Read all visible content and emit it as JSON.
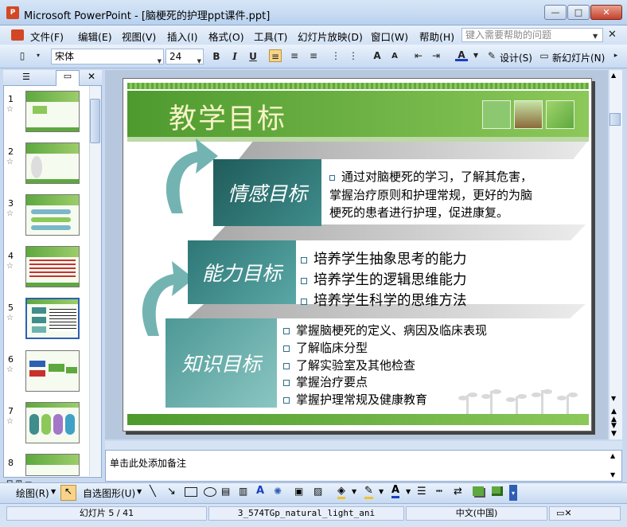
{
  "window": {
    "title": "Microsoft PowerPoint - [脑梗死的护理ppt课件.ppt]",
    "min": "—",
    "max": "□",
    "close": "✕"
  },
  "menu": {
    "items": [
      "文件(F)",
      "编辑(E)",
      "视图(V)",
      "插入(I)",
      "格式(O)",
      "工具(T)",
      "幻灯片放映(D)",
      "窗口(W)",
      "帮助(H)"
    ],
    "help_placeholder": "键入需要帮助的问题"
  },
  "toolbar": {
    "font": "宋体",
    "size": "24",
    "bold": "B",
    "italic": "I",
    "underline": "U",
    "design": "设计(S)",
    "new_slide": "新幻灯片(N)"
  },
  "thumbnails": {
    "numbers": [
      "1",
      "2",
      "3",
      "4",
      "5",
      "6",
      "7",
      "8"
    ],
    "selected": "5"
  },
  "slide": {
    "title": "教学目标",
    "boxes": [
      "情感目标",
      "能力目标",
      "知识目标"
    ],
    "emotion_text": [
      "通过对脑梗死的学习，了解其危害，",
      "掌握治疗原则和护理常规，更好的为脑",
      "梗死的患者进行护理，促进康复。"
    ],
    "ability_items": [
      "培养学生抽象思考的能力",
      "培养学生的逻辑思维能力",
      "培养学生科学的思维方法"
    ],
    "knowledge_items": [
      "掌握脑梗死的定义、病因及临床表现",
      "了解临床分型",
      "了解实验室及其他检查",
      "掌握治疗要点",
      "掌握护理常规及健康教育"
    ]
  },
  "notes": {
    "placeholder": "单击此处添加备注"
  },
  "drawbar": {
    "draw": "绘图(R)",
    "autoshapes": "自选图形(U)"
  },
  "status": {
    "slide": "幻灯片 5 / 41",
    "template": "3_574TGp_natural_light_ani",
    "language": "中文(中国)"
  },
  "colors": {
    "accent_green": "#5ea83f",
    "teal_dark": "#2d6f6e",
    "teal_mid": "#3f8d8c",
    "teal_light": "#6fb3b0"
  }
}
